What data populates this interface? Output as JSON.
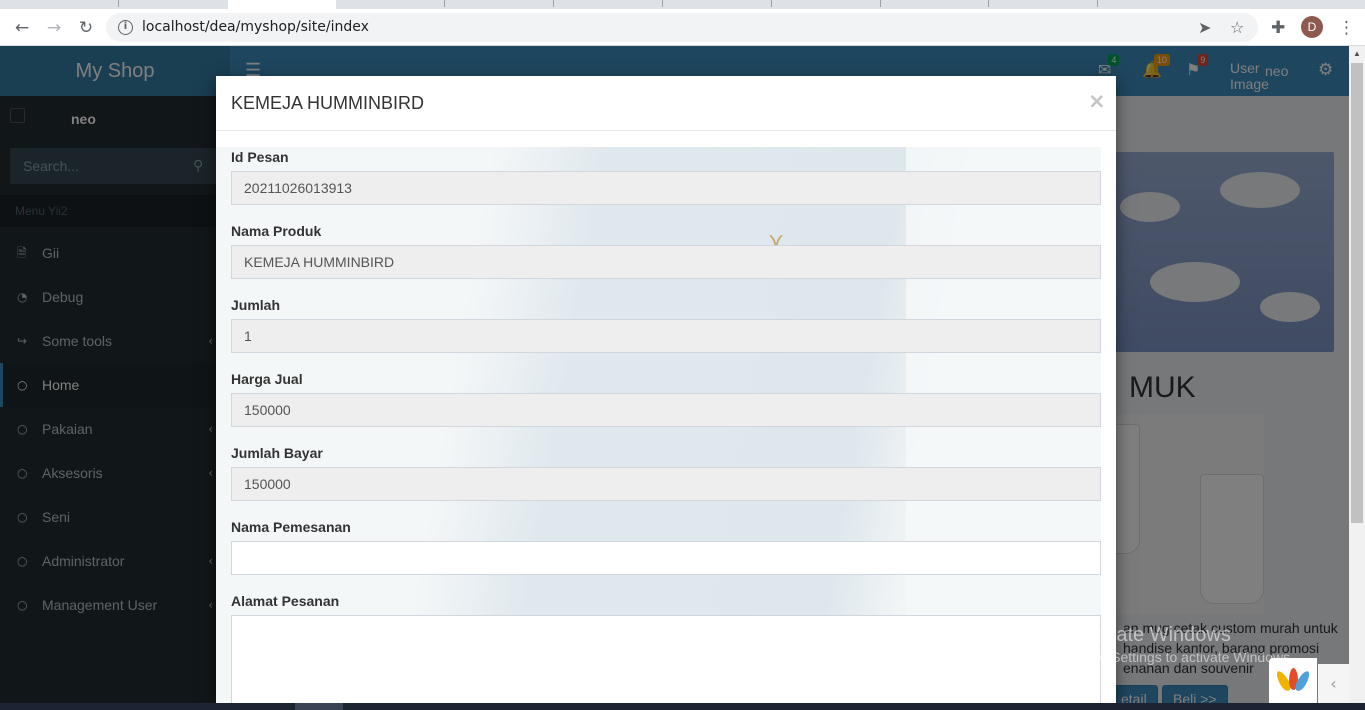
{
  "browser": {
    "url": "localhost/dea/myshop/site/index",
    "profile_initial": "D",
    "back_icon": "arrow-left-icon",
    "forward_icon": "arrow-right-icon",
    "reload_icon": "reload-icon"
  },
  "app": {
    "brand": "My Shop",
    "navbar": {
      "messages_count": "4",
      "notifications_count": "10",
      "tasks_count": "9",
      "user_image_alt": "User Image",
      "user_name": "neo"
    },
    "sidebar": {
      "user_name": "neo",
      "search_placeholder": "Search...",
      "menu_header": "Menu Yii2",
      "items": [
        {
          "label": "Gii",
          "icon": "file-code-icon"
        },
        {
          "label": "Debug",
          "icon": "dashboard-icon"
        },
        {
          "label": "Some tools",
          "icon": "share-icon"
        },
        {
          "label": "Home",
          "icon": "circle-icon"
        },
        {
          "label": "Pakaian",
          "icon": "circle-icon"
        },
        {
          "label": "Aksesoris",
          "icon": "circle-icon"
        },
        {
          "label": "Seni",
          "icon": "circle-icon"
        },
        {
          "label": "Administrator",
          "icon": "circle-icon"
        },
        {
          "label": "Management User",
          "icon": "circle-icon"
        }
      ]
    },
    "background_product": {
      "title": "MUK",
      "description": "an mug cetak custom murah untuk handise kantor, barang promosi enanan dan souvenir",
      "detail_button": "etail",
      "buy_button": "Beli >>"
    }
  },
  "modal": {
    "title": "KEMEJA HUMMINBIRD",
    "close_label": "×",
    "fields": {
      "id_pesan": {
        "label": "Id Pesan",
        "value": "20211026013913"
      },
      "nama_produk": {
        "label": "Nama Produk",
        "value": "KEMEJA HUMMINBIRD"
      },
      "jumlah": {
        "label": "Jumlah",
        "value": "1"
      },
      "harga_jual": {
        "label": "Harga Jual",
        "value": "150000"
      },
      "jumlah_bayar": {
        "label": "Jumlah Bayar",
        "value": "150000"
      },
      "nama_pemesanan": {
        "label": "Nama Pemesanan",
        "value": ""
      },
      "alamat_pesanan": {
        "label": "Alamat Pesanan",
        "value": ""
      }
    }
  },
  "os": {
    "watermark_title": "Activate Windows",
    "watermark_subtitle": "Go to Settings to activate Windows."
  },
  "colors": {
    "accent": "#3c8dbc",
    "sidebar_bg": "#222d32",
    "label_success": "#00a65a",
    "label_warning": "#f39c12",
    "label_danger": "#dd4b39"
  }
}
